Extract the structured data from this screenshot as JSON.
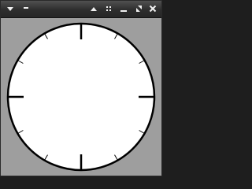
{
  "window": {
    "title": "",
    "buttons": [
      {
        "name": "window-menu-button",
        "icon": "triangle-down-icon"
      },
      {
        "name": "shade-button",
        "icon": "dash-icon"
      },
      {
        "name": "keep-above-button",
        "icon": "triangle-up-icon"
      },
      {
        "name": "on-all-desktops-button",
        "icon": "four-dots-icon"
      },
      {
        "name": "minimize-button",
        "icon": "minimize-icon"
      },
      {
        "name": "maximize-button",
        "icon": "maximize-icon"
      },
      {
        "name": "close-button",
        "icon": "close-icon"
      }
    ]
  },
  "clock": {
    "face_color": "#ffffff",
    "outline_color": "#000000",
    "background_color": "#9e9e9e",
    "hour_marks": 12,
    "major_marks": [
      12,
      3,
      6,
      9
    ],
    "hands_visible": false
  }
}
